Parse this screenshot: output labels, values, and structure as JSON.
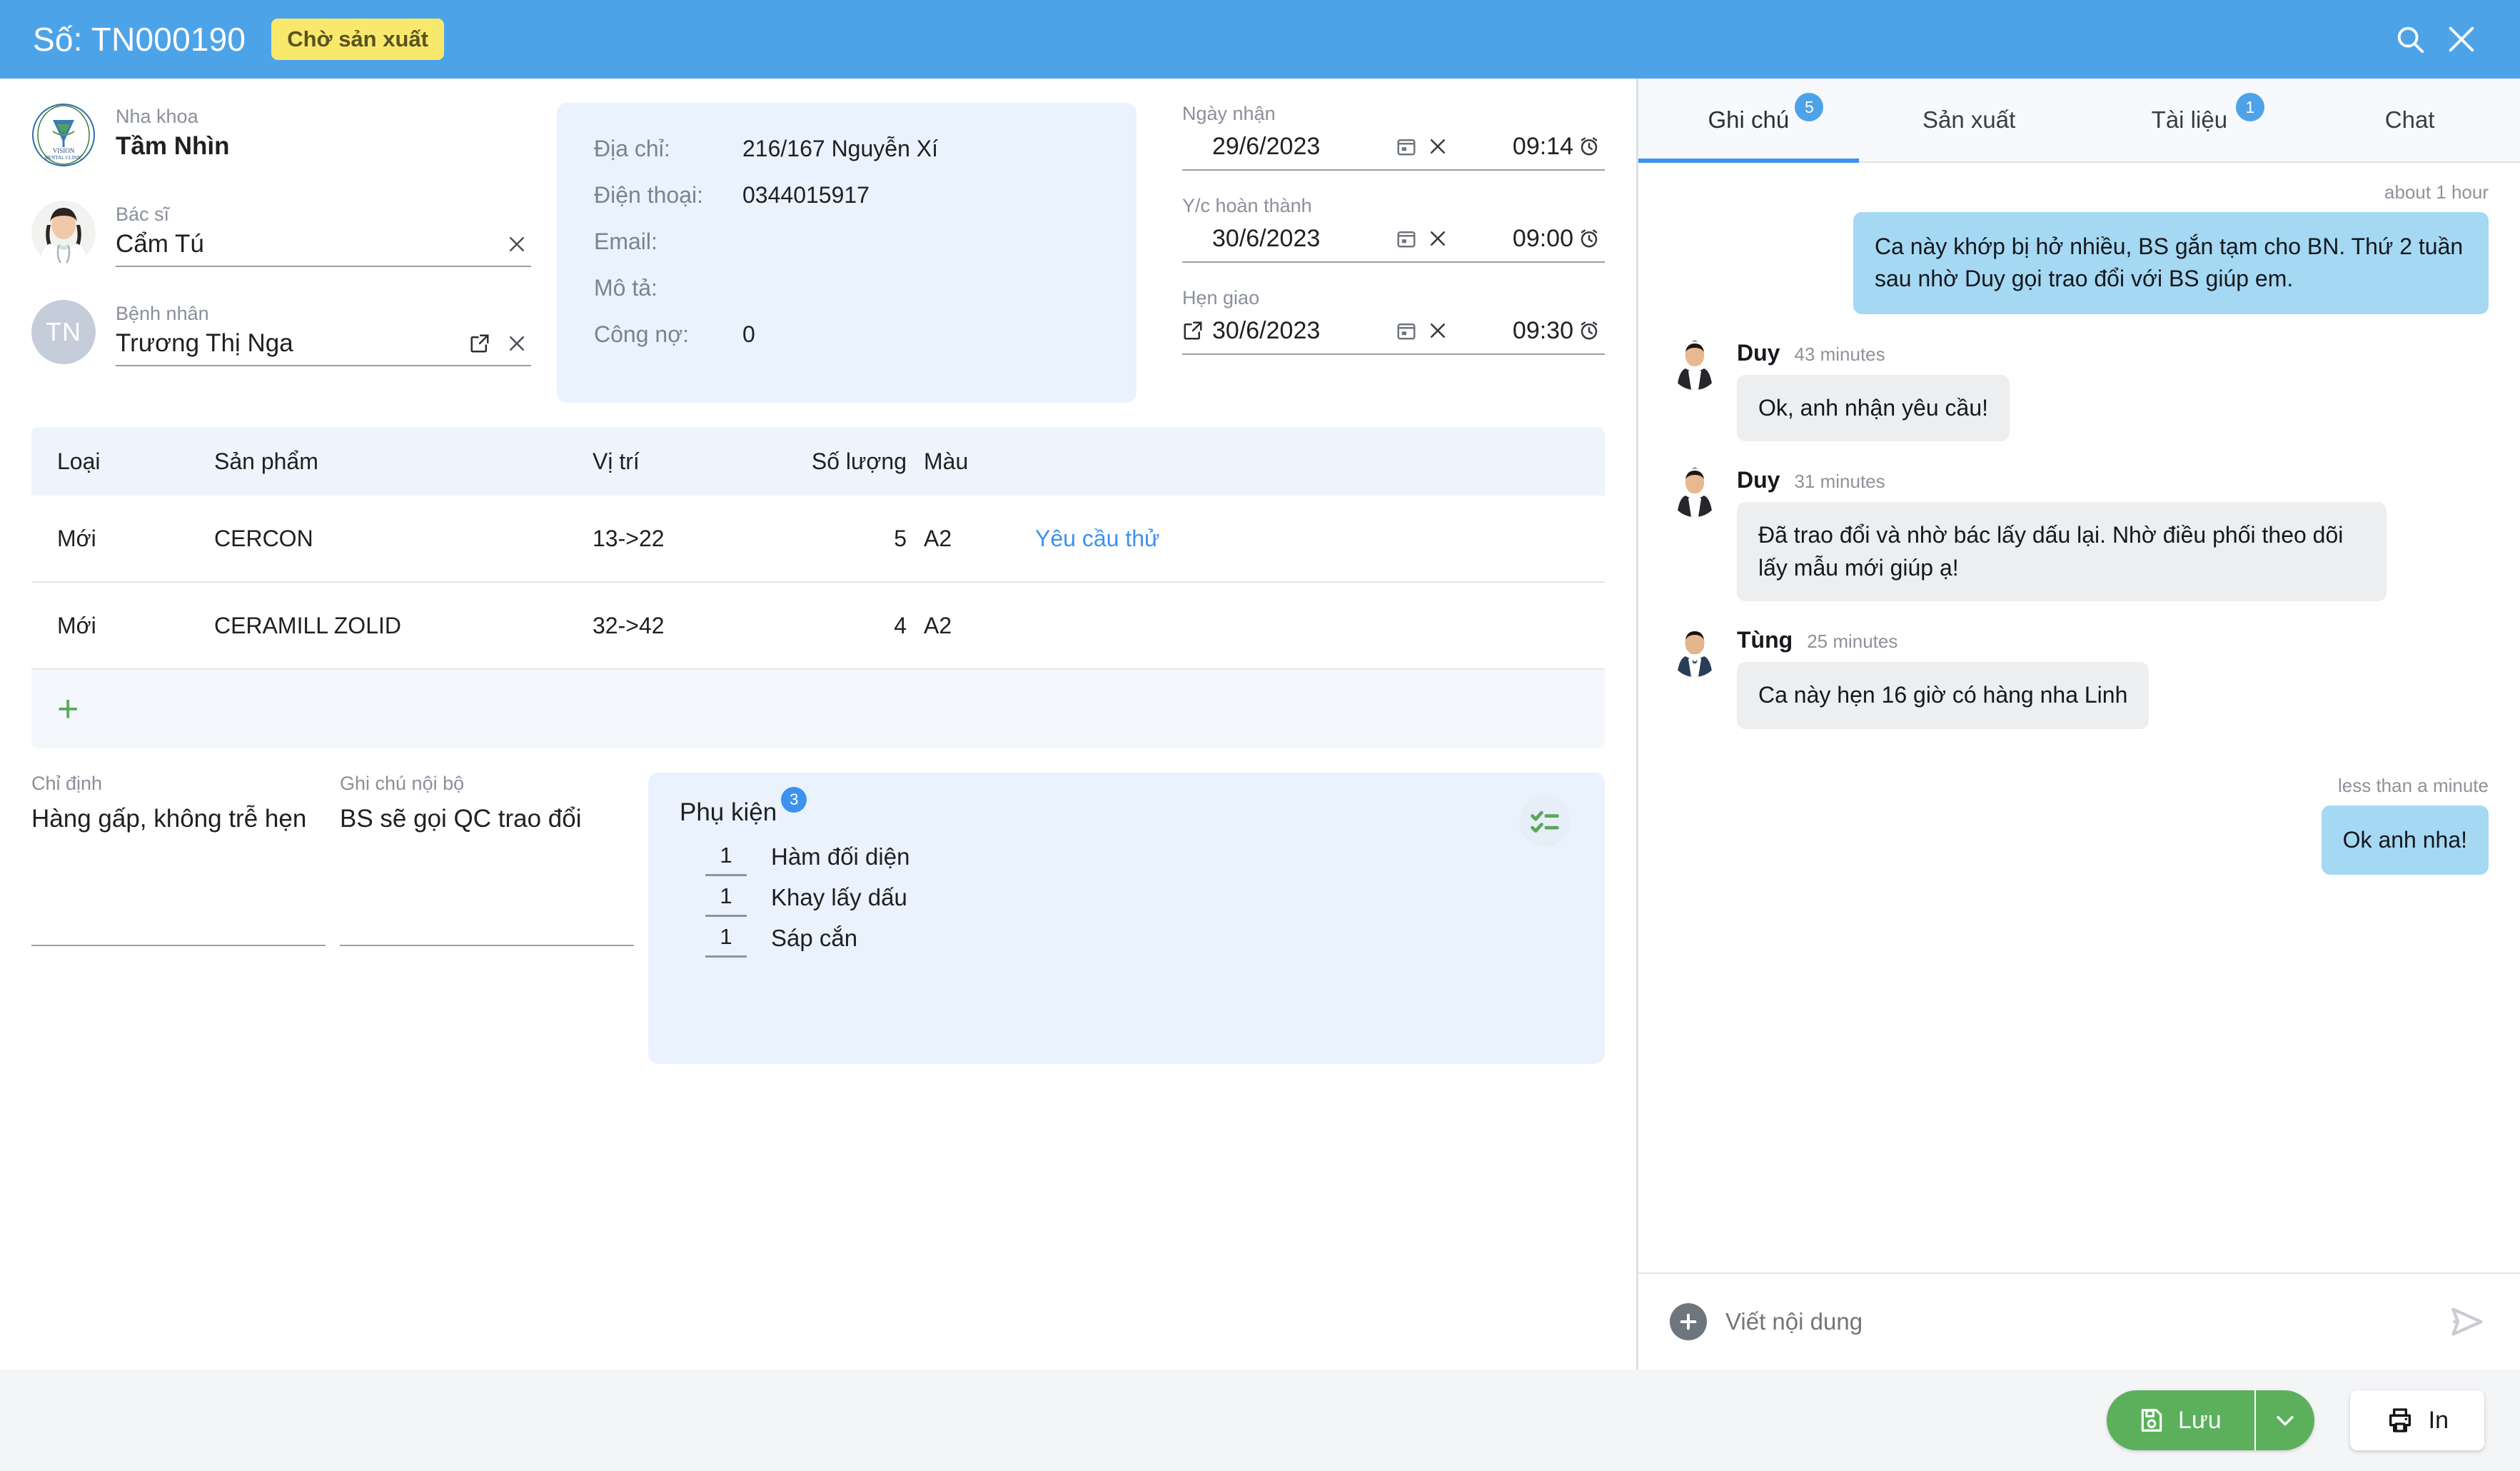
{
  "header": {
    "title": "Số: TN000190",
    "status_badge": "Chờ sản xuất",
    "search_icon": "search-icon",
    "close_icon": "close-icon",
    "bg_color": "#4da3e8",
    "badge_color": "#f8e96d"
  },
  "parties": {
    "clinic": {
      "label": "Nha khoa",
      "value": "Tầm Nhìn"
    },
    "doctor": {
      "label": "Bác sĩ",
      "value": "Cẩm Tú",
      "clear_icon": "close-icon"
    },
    "patient": {
      "label": "Bệnh nhân",
      "value": "Trương Thị Nga",
      "initials": "TN",
      "open_icon": "external-link-icon",
      "clear_icon": "close-icon"
    }
  },
  "info": {
    "address_label": "Địa chỉ:",
    "address_value": "216/167 Nguyễn Xí",
    "phone_label": "Điện thoại:",
    "phone_value": "0344015917",
    "email_label": "Email:",
    "email_value": "",
    "description_label": "Mô tả:",
    "description_value": "",
    "debt_label": "Công nợ:",
    "debt_value": "0"
  },
  "dates": [
    {
      "label": "Ngày nhận",
      "date": "29/6/2023",
      "time": "09:14",
      "has_external": false,
      "calendar_icon": "calendar-icon",
      "clear_icon": "close-icon",
      "clock_icon": "alarm-clock-icon"
    },
    {
      "label": "Y/c hoàn thành",
      "date": "30/6/2023",
      "time": "09:00",
      "has_external": false,
      "calendar_icon": "calendar-icon",
      "clear_icon": "close-icon",
      "clock_icon": "alarm-clock-icon"
    },
    {
      "label": "Hẹn giao",
      "date": "30/6/2023",
      "time": "09:30",
      "has_external": true,
      "calendar_icon": "calendar-icon",
      "clear_icon": "close-icon",
      "clock_icon": "alarm-clock-icon"
    }
  ],
  "table": {
    "columns": [
      "Loại",
      "Sản phẩm",
      "Vị trí",
      "Số lượng",
      "Màu",
      ""
    ],
    "rows": [
      {
        "type": "Mới",
        "product": "CERCON",
        "position": "13->22",
        "qty": "5",
        "color": "A2",
        "action": "Yêu cầu thử"
      },
      {
        "type": "Mới",
        "product": "CERAMILL ZOLID",
        "position": "32->42",
        "qty": "4",
        "color": "A2",
        "action": ""
      }
    ],
    "add_row_icon": "plus-icon"
  },
  "notes": {
    "order_label": "Chỉ định",
    "order_value": "Hàng gấp, không trễ hẹn",
    "internal_label": "Ghi chú nội bộ",
    "internal_value": "BS sẽ gọi QC trao đổi"
  },
  "accessories": {
    "title": "Phụ kiện",
    "count": "3",
    "checklist_icon": "checklist-icon",
    "items": [
      {
        "qty": "1",
        "name": "Hàm đối diện"
      },
      {
        "qty": "1",
        "name": "Khay lấy dấu"
      },
      {
        "qty": "1",
        "name": "Sáp cắn"
      }
    ]
  },
  "panel": {
    "tabs": [
      {
        "label": "Ghi chú",
        "badge": "5",
        "active": true
      },
      {
        "label": "Sản xuất",
        "badge": "",
        "active": false
      },
      {
        "label": "Tài liệu",
        "badge": "1",
        "active": false
      },
      {
        "label": "Chat",
        "badge": "",
        "active": false
      }
    ],
    "messages": [
      {
        "direction": "out",
        "time": "about 1 hour",
        "text": "Ca này khớp bị hở nhiều, BS gắn tạm cho BN. Thứ 2 tuần sau nhờ Duy gọi trao đổi với BS giúp em."
      },
      {
        "direction": "in",
        "author": "Duy",
        "time": "43 minutes",
        "text": "Ok, anh nhận yêu cầu!"
      },
      {
        "direction": "in",
        "author": "Duy",
        "time": "31 minutes",
        "text": "Đã trao đổi và nhờ bác lấy dấu lại. Nhờ điều phối theo dõi lấy mẫu mới giúp ạ!"
      },
      {
        "direction": "in",
        "author": "Tùng",
        "time": "25 minutes",
        "text": "Ca này hẹn 16 giờ có hàng nha Linh"
      },
      {
        "direction": "out",
        "time": "less than a minute",
        "text": "Ok anh nha!"
      }
    ],
    "composer": {
      "placeholder": "Viết nội dung",
      "add_icon": "plus-icon",
      "send_icon": "send-icon"
    }
  },
  "footer": {
    "save_label": "Lưu",
    "save_icon": "save-icon",
    "save_caret_icon": "chevron-down-icon",
    "print_label": "In",
    "print_icon": "printer-icon"
  }
}
